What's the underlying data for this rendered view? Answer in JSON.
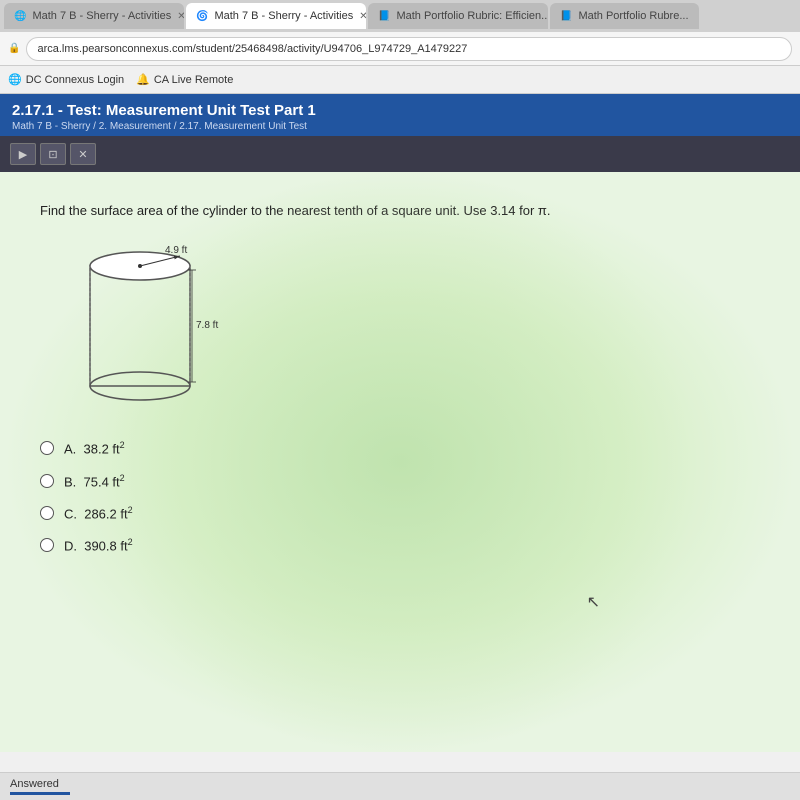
{
  "browser": {
    "tabs": [
      {
        "id": "tab1",
        "label": "Math 7 B - Sherry - Activities",
        "active": false,
        "icon": "🌐"
      },
      {
        "id": "tab2",
        "label": "Math 7 B - Sherry - Activities",
        "active": true,
        "icon": "🌀"
      },
      {
        "id": "tab3",
        "label": "Math Portfolio Rubric: Efficien...",
        "active": false,
        "icon": "📘"
      },
      {
        "id": "tab4",
        "label": "Math Portfolio Rubre...",
        "active": false,
        "icon": "📘"
      }
    ],
    "address": "arca.lms.pearsonconnexus.com/student/25468498/activity/U94706_L974729_A1479227",
    "bookmarks": [
      {
        "label": "DC Connexus Login",
        "icon": "🌐"
      },
      {
        "label": "CA Live Remote",
        "icon": "🔔"
      }
    ]
  },
  "page": {
    "title": "2.17.1 - Test: Measurement Unit Test Part 1",
    "breadcrumb": "Math 7 B - Sherry / 2. Measurement / 2.17. Measurement Unit Test"
  },
  "question": {
    "text": "Find the surface area of the cylinder to the nearest tenth of a square unit. Use 3.14 for π.",
    "cylinder": {
      "radius_label": "4.9 ft",
      "height_label": "7.8 ft"
    },
    "choices": [
      {
        "id": "A",
        "label": "A.  38.2 ft²"
      },
      {
        "id": "B",
        "label": "B.  75.4 ft²"
      },
      {
        "id": "C",
        "label": "C.  286.2 ft²"
      },
      {
        "id": "D",
        "label": "D.  390.8 ft²"
      }
    ]
  },
  "status": {
    "answered": "Answered"
  },
  "toolbar": {
    "buttons": [
      "▶",
      "⊡",
      "✕"
    ]
  }
}
